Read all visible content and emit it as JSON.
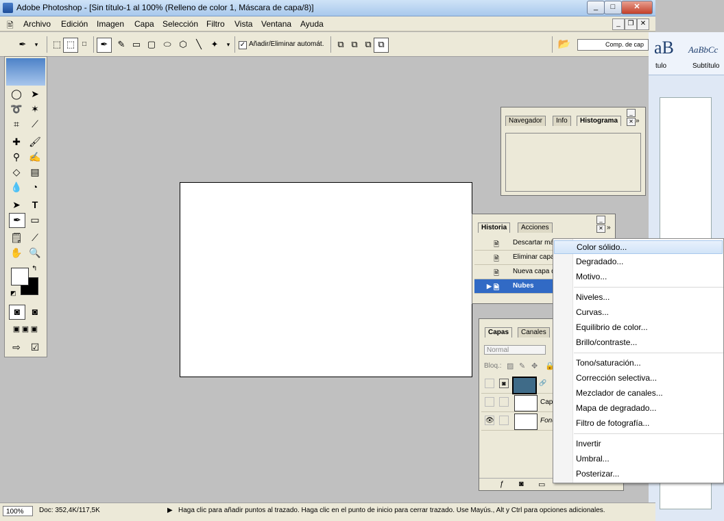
{
  "window": {
    "title": "Adobe Photoshop - [Sin título-1 al 100% (Relleno de color 1, Máscara de capa/8)]"
  },
  "menubar": {
    "items": [
      "Archivo",
      "Edición",
      "Imagen",
      "Capa",
      "Selección",
      "Filtro",
      "Vista",
      "Ventana",
      "Ayuda"
    ]
  },
  "options": {
    "auto_label": "Añadir/Eliminar automát.",
    "auto_checked": true,
    "comp_label": "Comp. de cap"
  },
  "word": {
    "style1": "aB",
    "style1_name": "tulo",
    "style2": "AaBbCc",
    "style2_name": "Subtítulo"
  },
  "navigator_panel": {
    "tabs": [
      "Navegador",
      "Info",
      "Histograma"
    ],
    "active": "Histograma"
  },
  "history_panel": {
    "tabs": [
      "Historia",
      "Acciones"
    ],
    "items": [
      "Descartar má",
      "Eliminar capa",
      "Nueva capa d",
      "Nubes"
    ],
    "selected_index": 3
  },
  "layers_panel": {
    "tabs": [
      "Capas",
      "Canales"
    ],
    "blend_mode": "Normal",
    "lock_label": "Bloq.:",
    "layers": [
      {
        "name": "",
        "visible": false
      },
      {
        "name": "Capa",
        "visible": false
      },
      {
        "name": "Fond",
        "visible": true
      }
    ]
  },
  "context_menu": {
    "groups": [
      [
        "Color sólido...",
        "Degradado...",
        "Motivo..."
      ],
      [
        "Niveles...",
        "Curvas...",
        "Equilibrio de color...",
        "Brillo/contraste..."
      ],
      [
        "Tono/saturación...",
        "Corrección selectiva...",
        "Mezclador de canales...",
        "Mapa de degradado...",
        "Filtro de fotografía..."
      ],
      [
        "Invertir",
        "Umbral...",
        "Posterizar..."
      ]
    ],
    "highlighted": "Color sólido..."
  },
  "status": {
    "zoom": "100%",
    "doc": "Doc: 352,4K/117,5K",
    "hint": "Haga clic para añadir puntos al trazado. Haga clic en el punto de inicio para cerrar trazado. Use Mayús., Alt y Ctrl para opciones adicionales."
  },
  "colors": {
    "accent": "#316ac5",
    "workspace": "#c0c0c0",
    "panel": "#ece9d8",
    "layer_fill": "#3f6b88"
  }
}
